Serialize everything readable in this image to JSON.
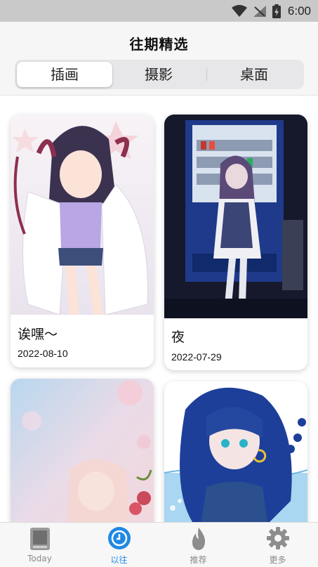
{
  "status_bar": {
    "time": "6:00"
  },
  "header": {
    "title": "往期精选",
    "tabs": [
      {
        "label": "插画",
        "active": true
      },
      {
        "label": "摄影",
        "active": false
      },
      {
        "label": "桌面",
        "active": false
      }
    ]
  },
  "cards": [
    {
      "title": "诶嘿～",
      "date": "2022-08-10"
    },
    {
      "title": "夜",
      "date": "2022-07-29"
    },
    {
      "title": "",
      "date": ""
    },
    {
      "title": "",
      "date": ""
    }
  ],
  "tabbar": {
    "items": [
      {
        "label": "Today",
        "icon": "book-icon"
      },
      {
        "label": "以往",
        "icon": "clock-icon",
        "active": true
      },
      {
        "label": "推荐",
        "icon": "flame-icon"
      },
      {
        "label": "更多",
        "icon": "gear-icon"
      }
    ]
  },
  "colors": {
    "accent": "#1e88e5",
    "status_bar": "#c9c9c9",
    "segment_bg": "#e7e7e9"
  }
}
